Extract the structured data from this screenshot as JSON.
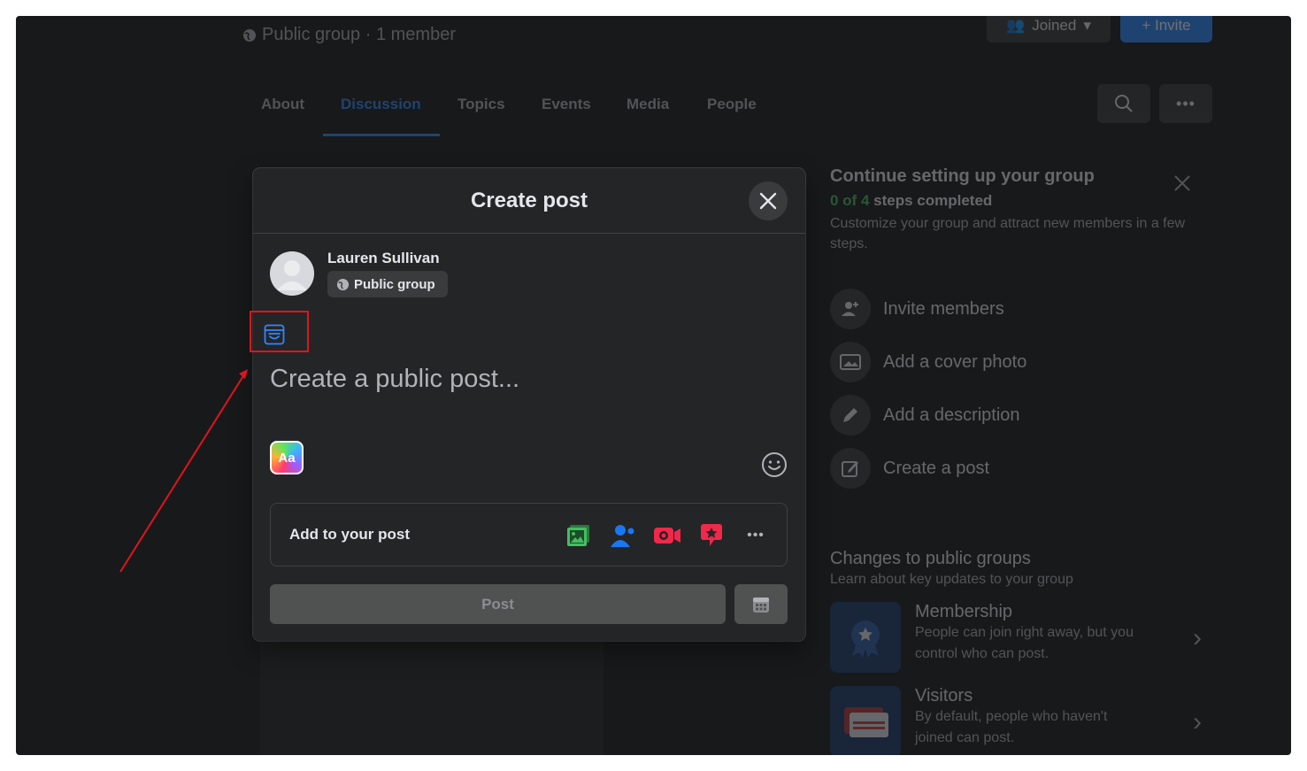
{
  "group_header": {
    "meta": "Public group · 1 member",
    "joined_label": "Joined",
    "invite_label": "+ Invite"
  },
  "tabs": [
    {
      "label": "About"
    },
    {
      "label": "Discussion",
      "active": true
    },
    {
      "label": "Topics"
    },
    {
      "label": "Events"
    },
    {
      "label": "Media"
    },
    {
      "label": "People"
    }
  ],
  "setup_panel": {
    "title": "Continue setting up your group",
    "progress_count": "0 of 4",
    "progress_suffix": "steps completed",
    "description": "Customize your group and attract new members in a few steps.",
    "steps": [
      {
        "label": "Invite members",
        "icon": "add-person-icon"
      },
      {
        "label": "Add a cover photo",
        "icon": "photo-icon"
      },
      {
        "label": "Add a description",
        "icon": "pencil-icon"
      },
      {
        "label": "Create a post",
        "icon": "compose-icon"
      }
    ]
  },
  "changes_panel": {
    "title": "Changes to public groups",
    "subtitle": "Learn about key updates to your group",
    "items": [
      {
        "title": "Membership",
        "description": "People can join right away, but you control who can post."
      },
      {
        "title": "Visitors",
        "description": "By default, people who haven't joined can post."
      }
    ]
  },
  "modal": {
    "title": "Create post",
    "user_name": "Lauren Sullivan",
    "audience_label": "Public group",
    "placeholder": "Create a public post...",
    "aa_label": "Aa",
    "add_to_post_label": "Add to your post",
    "post_button_label": "Post",
    "add_icons": [
      "photo-video-icon",
      "tag-people-icon",
      "live-video-icon",
      "feeling-icon",
      "more-icon"
    ]
  },
  "colors": {
    "accent": "#2d88ff",
    "progress_green": "#45bd62",
    "annotation_red": "#e0141e"
  }
}
